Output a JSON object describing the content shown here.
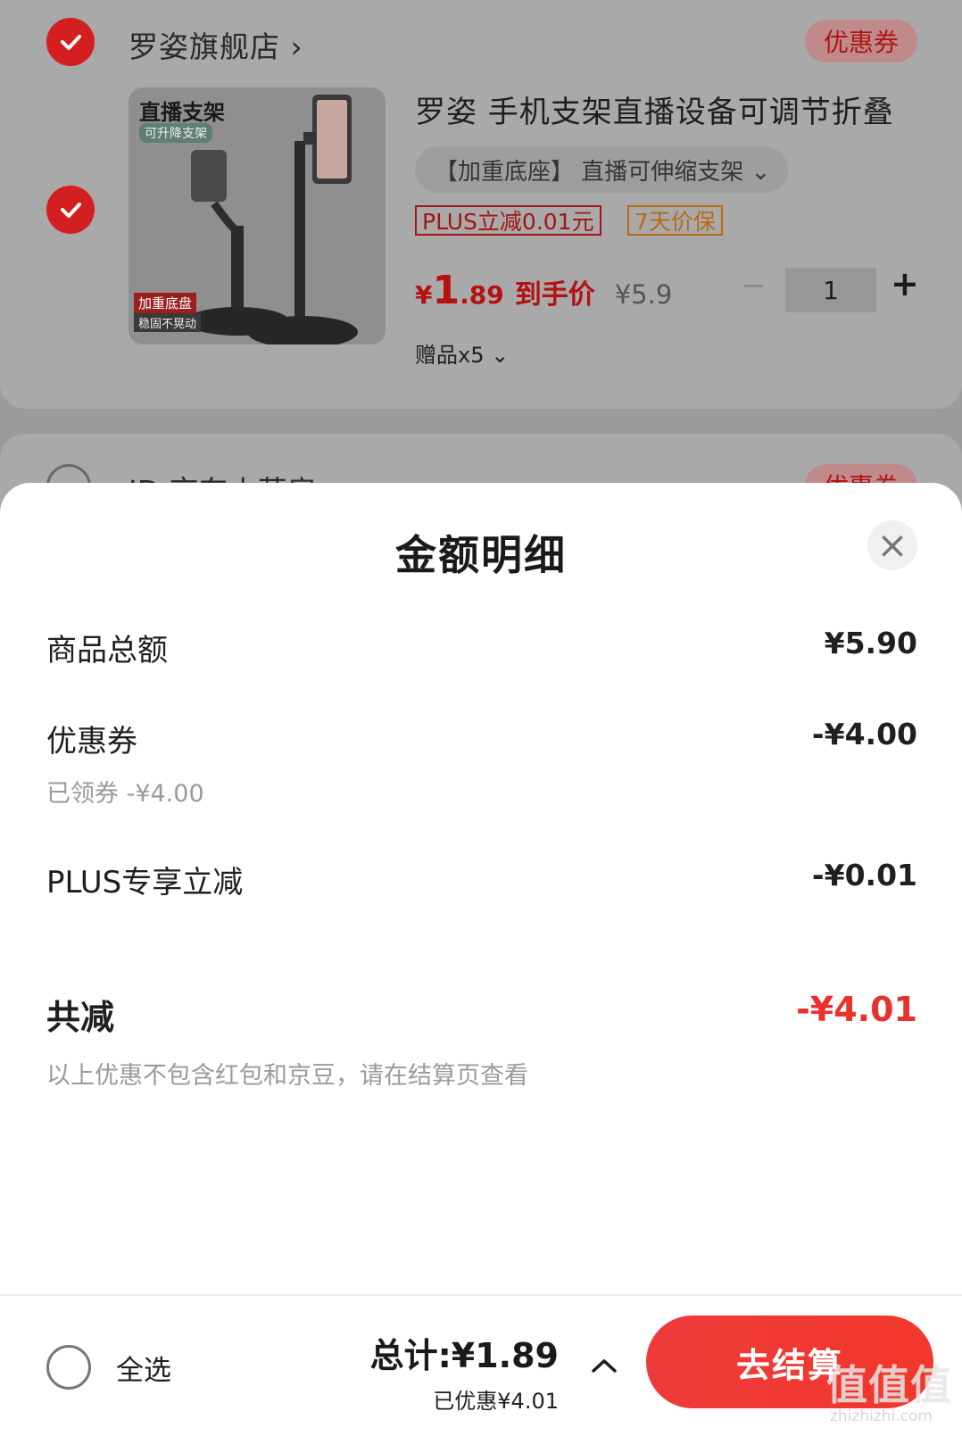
{
  "cart": {
    "store1": {
      "name": "罗姿旗舰店 ›",
      "coupon_label": "优惠券",
      "product": {
        "image_title": "直播支架",
        "image_tag1": "可升降支架",
        "image_tag2": "加重底盘",
        "image_tag3": "稳固不晃动",
        "title": "罗姿 手机支架直播设备可调节折叠",
        "spec": "【加重底座】 直播可伸缩支架 ⌄",
        "tag_plus": "PLUS立减0.01元",
        "tag_price_protect": "7天价保",
        "price_symbol": "¥",
        "price_int": "1",
        "price_dec": ".89",
        "price_label": "到手价",
        "original_price": "¥5.9",
        "qty_minus": "−",
        "quantity": "1",
        "qty_plus": "+",
        "gift": "赠品x5 ⌄"
      }
    },
    "store2": {
      "name": "JD 京东小药房 ›",
      "coupon_label": "优惠券"
    }
  },
  "sheet": {
    "title": "金额明细",
    "close_icon": "×",
    "rows": [
      {
        "label": "商品总额",
        "value": "¥5.90"
      },
      {
        "label": "优惠券",
        "value": "-¥4.00",
        "sub": "已领券 -¥4.00"
      },
      {
        "label": "PLUS专享立减",
        "value": "-¥0.01"
      }
    ],
    "total_label": "共减",
    "total_value": "-¥4.01",
    "note": "以上优惠不包含红包和京豆，请在结算页查看"
  },
  "footer": {
    "select_all": "全选",
    "total": "总计:¥1.89",
    "saved": "已优惠¥4.01",
    "checkout": "去结算",
    "watermark": "值值值",
    "watermark_url": "zhizhizhi.com"
  },
  "colors": {
    "accent": "#e8322d",
    "price": "#b51111"
  }
}
